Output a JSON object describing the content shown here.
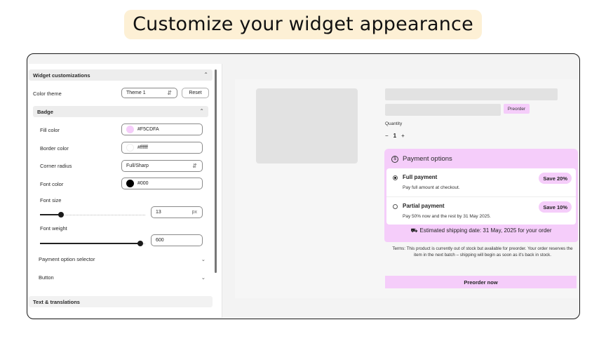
{
  "headline": "Customize your widget appearance",
  "panel": {
    "widget_section": "Widget customizations",
    "color_theme_label": "Color theme",
    "color_theme_value": "Theme 1",
    "reset_label": "Reset",
    "badge_section": "Badge",
    "fill_color_label": "Fill color",
    "fill_color_value": "#F5CDFA",
    "border_color_label": "Border color",
    "border_color_value": "#ffffff",
    "corner_radius_label": "Corner radius",
    "corner_radius_value": "Full/Sharp",
    "font_color_label": "Font color",
    "font_color_value": "#000",
    "font_size_label": "Font size",
    "font_size_value": "13",
    "font_size_unit": "px",
    "font_weight_label": "Font weight",
    "font_weight_value": "600",
    "payment_selector_label": "Payment option selector",
    "button_label": "Button",
    "text_translations_label": "Text & translations"
  },
  "preview": {
    "preorder_tag": "Preorder",
    "quantity_label": "Quantity",
    "qty_minus": "−",
    "qty_value": "1",
    "qty_plus": "+",
    "options_title": "Payment options",
    "full_name": "Full payment",
    "full_sub": "Pay full amount at checkout.",
    "full_save": "Save 20%",
    "partial_name": "Partial payment",
    "partial_sub": "Pay 50% now and the rest by 31 May 2025.",
    "partial_save": "Save 10%",
    "shipping": "Estimated shipping date: 31 May, 2025 for your order",
    "terms": "Terms: This product is currently out of stock but available for preorder. Your order reserves the item in the next batch – shipping will begin as soon as it's back in stock.",
    "preorder_now": "Preorder now"
  },
  "colors": {
    "accent": "#F5CDFA",
    "headline_bg": "#FDF0D5",
    "font_color": "#000000"
  },
  "icons": {
    "coin": "dollar-circle-icon",
    "truck": "truck-icon"
  },
  "sliders": {
    "font_size_fraction": 0.2,
    "font_weight_fraction": 0.95
  }
}
